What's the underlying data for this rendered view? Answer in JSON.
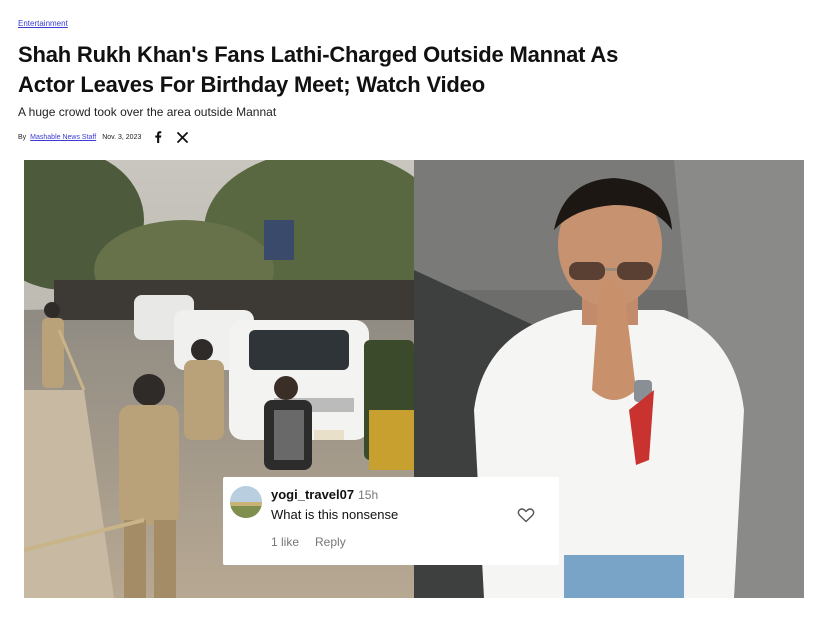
{
  "article": {
    "category": "Entertainment",
    "headline": "Shah Rukh Khan's Fans Lathi-Charged Outside Mannat As Actor Leaves For Birthday Meet; Watch Video",
    "subhead": "A huge crowd took over the area outside Mannat",
    "byline": {
      "prefix": "By",
      "author": "Mashable News Staff",
      "date": "Nov. 3, 2023"
    },
    "share_icons": [
      "facebook-icon",
      "x-icon"
    ]
  },
  "hero_image": {
    "comment": {
      "username": "yogi_travel07",
      "time": "15h",
      "text": "What is this nonsense",
      "likes": "1 like",
      "reply": "Reply"
    }
  }
}
